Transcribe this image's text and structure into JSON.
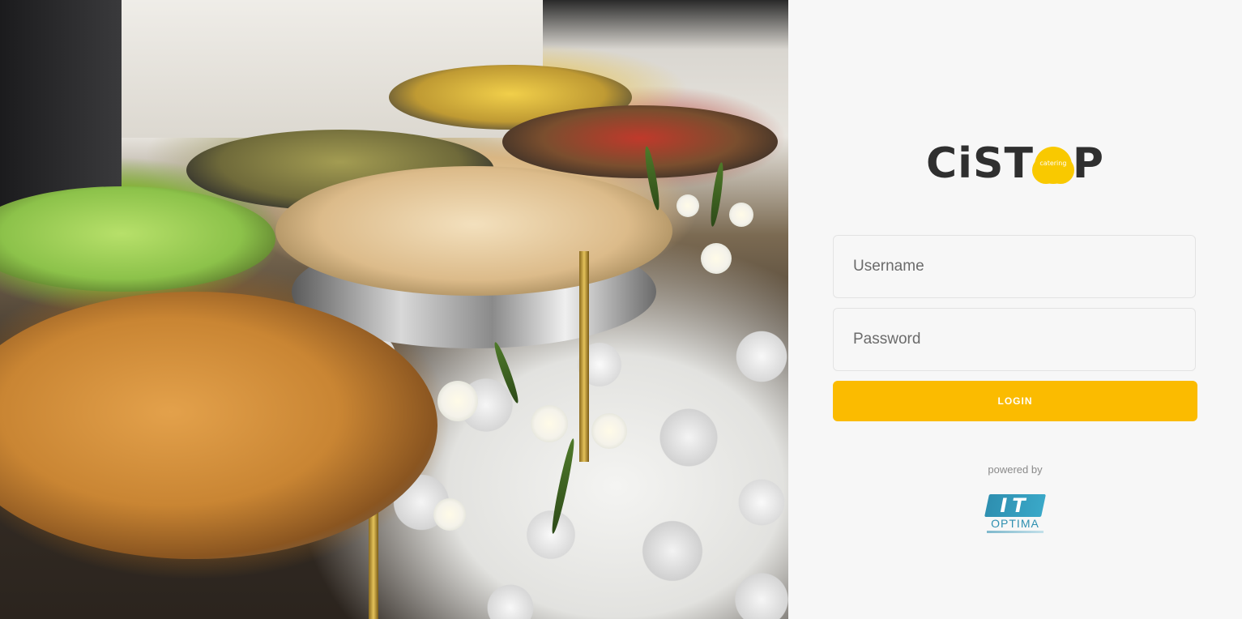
{
  "brand": {
    "name_part1": "CiST",
    "name_part2": "P",
    "cloud_text": "catering",
    "accent_color": "#fbbb00"
  },
  "login_form": {
    "username_placeholder": "Username",
    "password_placeholder": "Password",
    "username_value": "",
    "password_value": "",
    "submit_label": "LOGIN"
  },
  "footer": {
    "powered_by": "powered by",
    "partner_logo_mark": "IT",
    "partner_logo_text": "OPTIMA"
  },
  "hero": {
    "image_icon": "catering-buffet-photo"
  }
}
